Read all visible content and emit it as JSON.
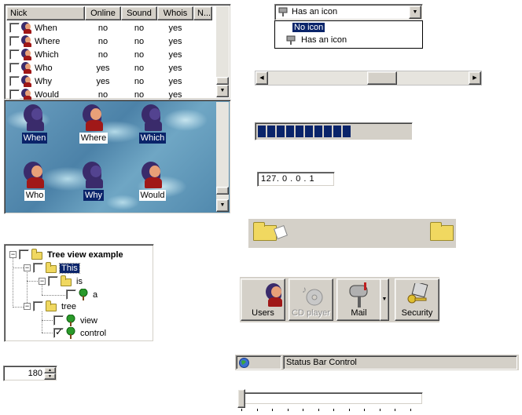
{
  "listview": {
    "columns": [
      "Nick",
      "Online",
      "Sound",
      "Whois",
      "N..."
    ],
    "rows": [
      {
        "nick": "When",
        "online": "no",
        "sound": "no",
        "whois": "yes"
      },
      {
        "nick": "Where",
        "online": "no",
        "sound": "no",
        "whois": "yes"
      },
      {
        "nick": "Which",
        "online": "no",
        "sound": "no",
        "whois": "yes"
      },
      {
        "nick": "Who",
        "online": "yes",
        "sound": "no",
        "whois": "yes"
      },
      {
        "nick": "Why",
        "online": "yes",
        "sound": "no",
        "whois": "yes"
      },
      {
        "nick": "Would",
        "online": "no",
        "sound": "no",
        "whois": "yes"
      }
    ]
  },
  "iconview": {
    "items": [
      {
        "label": "When",
        "selected": true
      },
      {
        "label": "Where",
        "selected": false
      },
      {
        "label": "Which",
        "selected": true
      },
      {
        "label": "Who",
        "selected": false
      },
      {
        "label": "Why",
        "selected": true
      },
      {
        "label": "Would",
        "selected": false
      }
    ]
  },
  "combo": {
    "selected": "Has an icon",
    "options": [
      "No icon",
      "Has an icon"
    ],
    "highlighted": "No icon"
  },
  "progress": {
    "blocks": 10,
    "fraction": 0.6
  },
  "ip": {
    "value": "127. 0 . 0 . 1"
  },
  "tree": {
    "root": "Tree view example",
    "this": "This",
    "is": "is",
    "a": "a",
    "tree": "tree",
    "view": "view",
    "control": "control"
  },
  "spinner": {
    "value": "180"
  },
  "toolbar": {
    "users": "Users",
    "cdplayer": "CD player",
    "mail": "Mail",
    "security": "Security"
  },
  "statusbar": {
    "text": "Status Bar Control"
  }
}
